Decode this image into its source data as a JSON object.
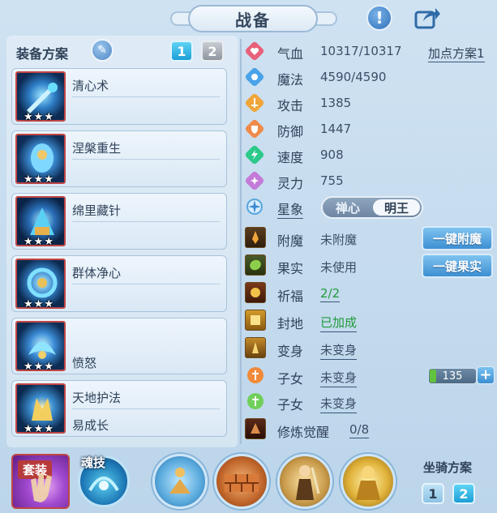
{
  "title": "战备",
  "equip": {
    "title": "装备方案",
    "plans": [
      "1",
      "2"
    ],
    "active_plan": "1"
  },
  "skills": [
    {
      "name": "清心术",
      "sub": "",
      "stars": "★★★"
    },
    {
      "name": "涅槃重生",
      "sub": "",
      "stars": "★★★"
    },
    {
      "name": "绵里藏针",
      "sub": "",
      "stars": "★★★"
    },
    {
      "name": "群体净心",
      "sub": "",
      "stars": "★★★"
    },
    {
      "name": "",
      "sub": "愤怒",
      "stars": "★★★"
    },
    {
      "name": "天地护法",
      "sub": "易成长",
      "stars": "★★★"
    }
  ],
  "stats": {
    "add_plan": "加点方案1",
    "items": [
      {
        "label": "气血",
        "value": "10317/10317",
        "icon": "heart-icon",
        "color": "#e8607a"
      },
      {
        "label": "魔法",
        "value": "4590/4590",
        "icon": "mana-icon",
        "color": "#4aa3e8"
      },
      {
        "label": "攻击",
        "value": "1385",
        "icon": "sword-icon",
        "color": "#f0a53a"
      },
      {
        "label": "防御",
        "value": "1447",
        "icon": "shield-icon",
        "color": "#ef8a4a"
      },
      {
        "label": "速度",
        "value": "908",
        "icon": "lightning-icon",
        "color": "#2cc98a"
      },
      {
        "label": "灵力",
        "value": "755",
        "icon": "spirit-icon",
        "color": "#c47ad8"
      }
    ],
    "star_label": "星象",
    "star_options": [
      "禅心",
      "明王"
    ]
  },
  "attrs": [
    {
      "label": "附魔",
      "value": "未附魔",
      "action": "一键附魔"
    },
    {
      "label": "果实",
      "value": "未使用",
      "action": "一键果实"
    },
    {
      "label": "祈福",
      "value": "2/2"
    },
    {
      "label": "封地",
      "value": "已加成"
    },
    {
      "label": "变身",
      "value": "未变身"
    },
    {
      "label": "子女",
      "value": "未变身",
      "number": "135",
      "plus": "+"
    },
    {
      "label": "子女",
      "value": "未变身"
    },
    {
      "label": "修炼觉醒",
      "value": "0/8"
    }
  ],
  "bottom": {
    "suit_label": "套装",
    "soul_label": "魂技",
    "mount_title": "坐骑方案",
    "mount_plans": [
      "1",
      "2"
    ],
    "mount_active": "2"
  }
}
